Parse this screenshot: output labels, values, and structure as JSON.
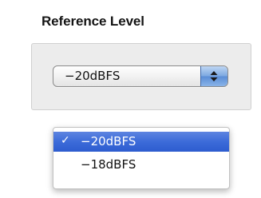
{
  "section": {
    "title": "Reference Level"
  },
  "popup": {
    "selected_value": "−20dBFS",
    "arrows_icon": "up-down-arrows-icon"
  },
  "menu": {
    "items": [
      {
        "label": "−20dBFS",
        "checkmark": "✓",
        "checked": true,
        "highlighted": true
      },
      {
        "label": "−18dBFS",
        "checkmark": "",
        "checked": false,
        "highlighted": false
      }
    ]
  },
  "colors": {
    "highlight": "#3c6bd9",
    "popup_arrow_accent": "#7ea9e1",
    "group_background": "#ececec"
  }
}
